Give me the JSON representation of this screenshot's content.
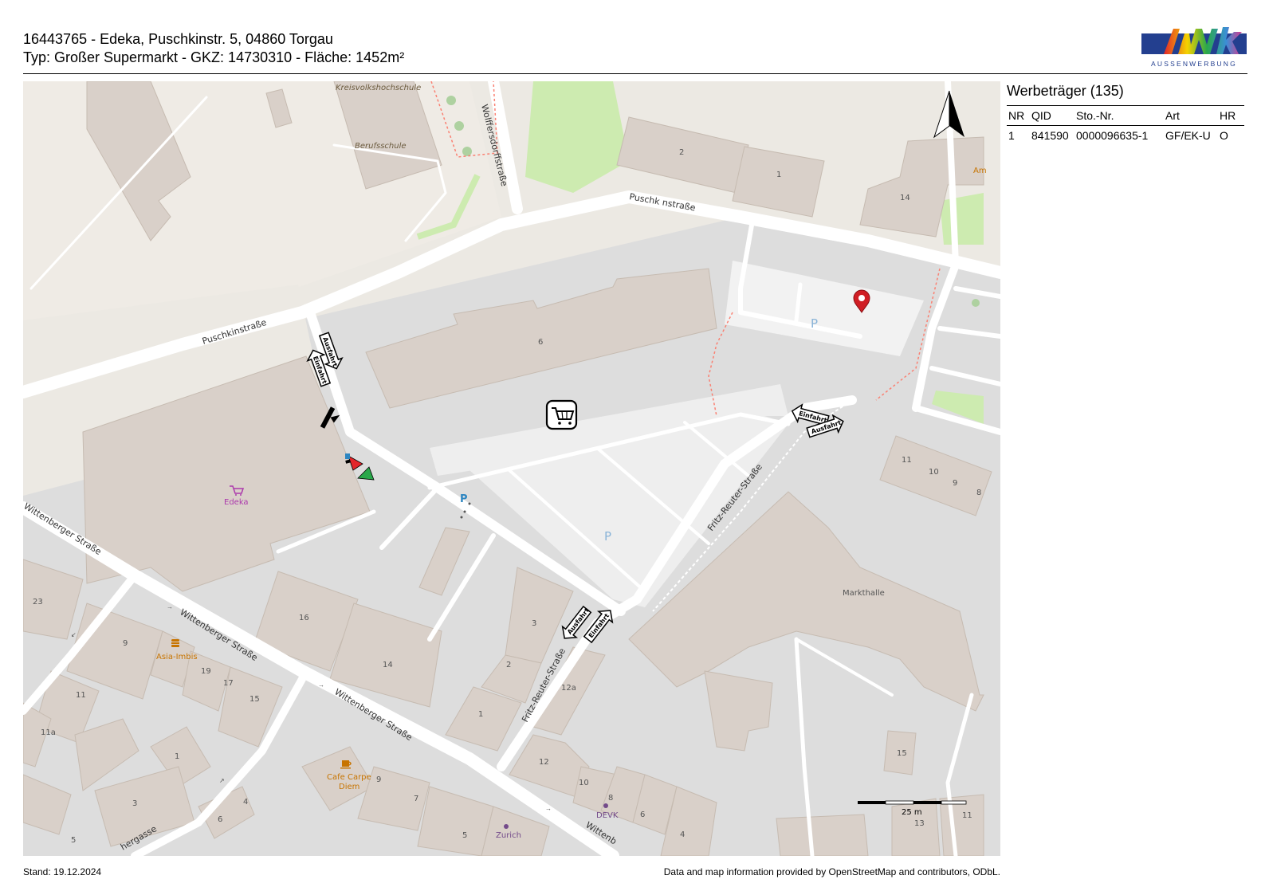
{
  "header": {
    "line1": "16443765 - Edeka, Puschkinstr. 5, 04860 Torgau",
    "line2": "Typ: Großer Supermarkt - GKZ: 14730310 - Fläche: 1452m²"
  },
  "logo": {
    "wordmark": "awk",
    "tagline": "AUSSENWERBUNG",
    "colors": {
      "primary": "#233f8f",
      "red": "#e3262a",
      "yellow": "#f5d200",
      "green": "#2aa84a",
      "magenta": "#d63a8e"
    }
  },
  "panel": {
    "title": "Werbeträger (135)",
    "columns": [
      "NR",
      "QID",
      "Sto.-Nr.",
      "Art",
      "HR"
    ],
    "rows": [
      [
        "1",
        "841590",
        "0000096635-1",
        "GF/EK-U",
        "O"
      ]
    ]
  },
  "map": {
    "colors": {
      "background": "#ece9e3",
      "building": "#d9d0c9",
      "road": "#ffffff",
      "parking": "#eeeeee",
      "area": "#dddddd",
      "green": "#cdebb0",
      "path": "#fa8072"
    },
    "streets": [
      "Puschkinstraße",
      "Puschk nstraße",
      "Wolffersdorffstraße",
      "Wittenberger Straße",
      "Wittenberger Straße",
      "Wittenberger Straße",
      "Wittenb",
      "Fritz-Reuter-Straße",
      "Fritz-Reuter-Straße",
      "hergasse"
    ],
    "places": [
      "Kreisvolkshochschule",
      "Berufsschule",
      "Markthalle",
      "Am"
    ],
    "pois": [
      {
        "name": "Edeka",
        "icon": "shopping-cart-icon",
        "color": "#ac39ac"
      },
      {
        "name": "Asia-Imbis",
        "icon": "fast-food-icon",
        "color": "#c77400"
      },
      {
        "name": "Cafe Carpe Diem",
        "icon": "coffee-cup-icon",
        "color": "#c77400"
      },
      {
        "name": "DEVK",
        "icon": "office-icon",
        "color": "#734a8a"
      },
      {
        "name": "Zurich",
        "icon": "office-icon",
        "color": "#734a8a"
      }
    ],
    "house_numbers": [
      "2",
      "1",
      "14",
      "6",
      "11",
      "10",
      "9",
      "8",
      "23",
      "16",
      "9",
      "19",
      "17",
      "15",
      "11",
      "11a",
      "1",
      "3",
      "6",
      "4",
      "5",
      "14",
      "3",
      "2",
      "1",
      "12a",
      "12",
      "10",
      "8",
      "6",
      "4",
      "15",
      "13",
      "11",
      "9",
      "7",
      "5"
    ],
    "parking_label": "P",
    "entrance_labels": {
      "entry": "Einfahrt",
      "exit": "Ausfahrt"
    },
    "scale_label": "25 m"
  },
  "footer": {
    "stand": "Stand: 19.12.2024",
    "attribution": "Data and map information provided by OpenStreetMap and contributors, ODbL."
  }
}
